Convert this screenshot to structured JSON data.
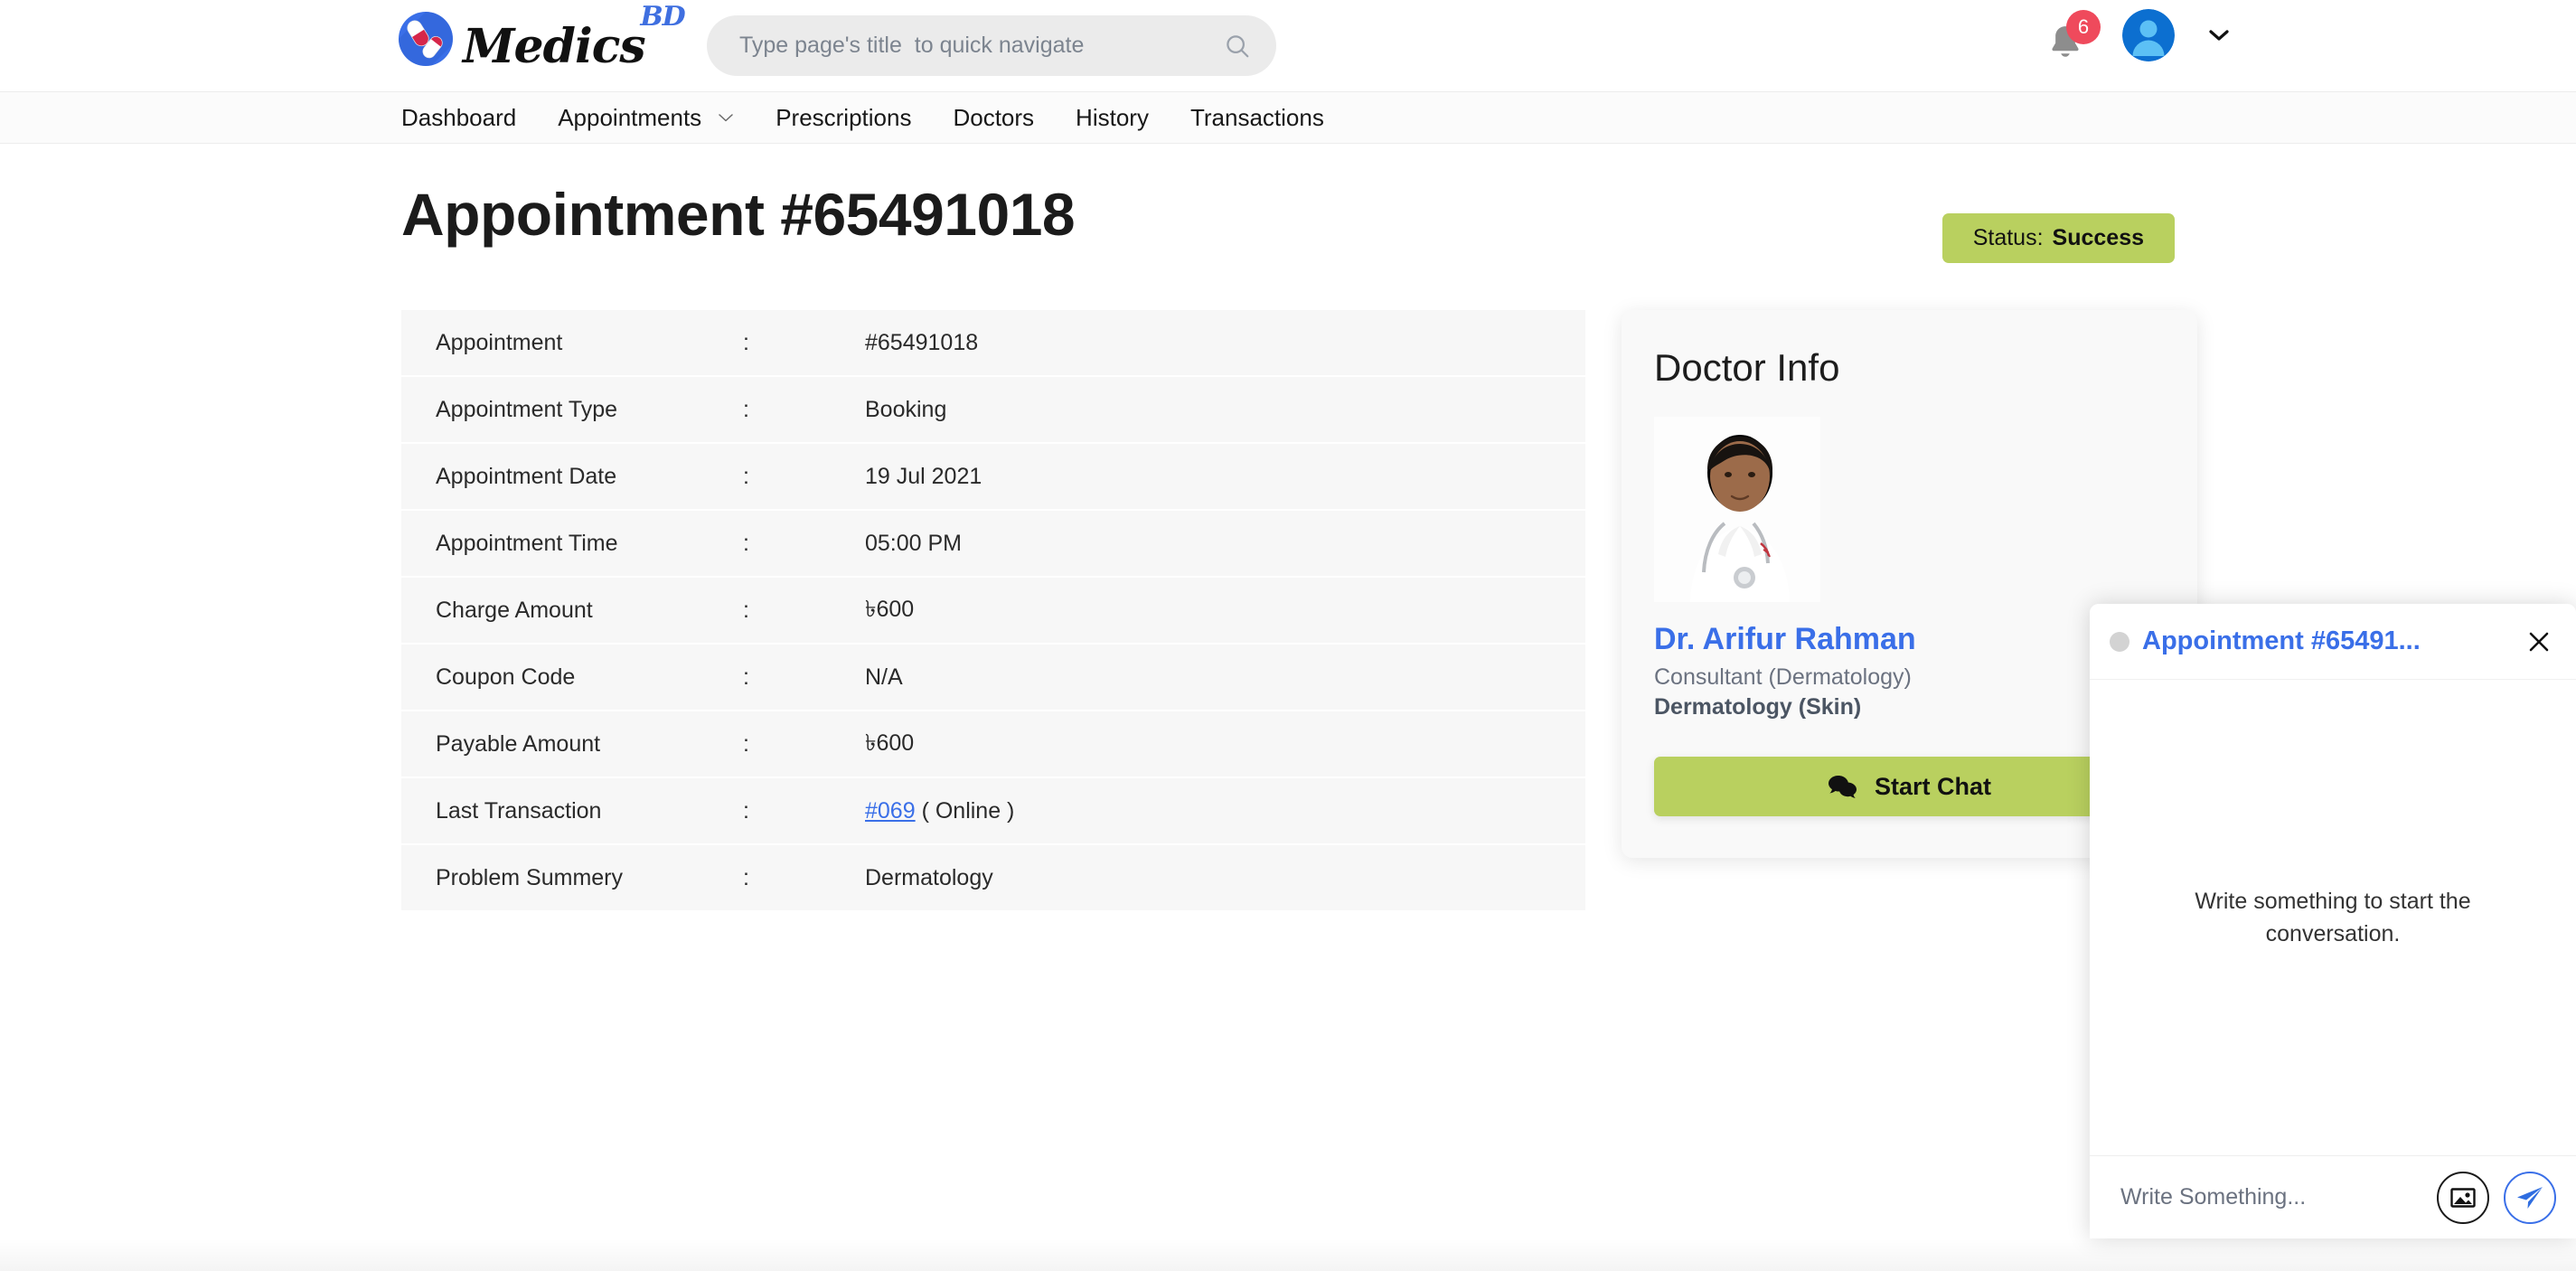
{
  "brand": {
    "name": "Medics",
    "superscript": "BD",
    "logo_icon": "pills-capsule-icon"
  },
  "search": {
    "placeholder": "Type page's title  to quick navigate",
    "value": "",
    "icon": "search-icon"
  },
  "topbar": {
    "notification_icon": "bell-icon",
    "notification_count": "6",
    "avatar_icon": "user-avatar-icon",
    "account_caret_icon": "chevron-down-icon"
  },
  "nav": {
    "items": [
      {
        "label": "Dashboard",
        "has_caret": false
      },
      {
        "label": "Appointments",
        "has_caret": true
      },
      {
        "label": "Prescriptions",
        "has_caret": false
      },
      {
        "label": "Doctors",
        "has_caret": false
      },
      {
        "label": "History",
        "has_caret": false
      },
      {
        "label": "Transactions",
        "has_caret": false
      }
    ]
  },
  "page": {
    "title": "Appointment #65491018",
    "status_label": "Status:",
    "status_value": "Success",
    "status_color": "#b9d05f"
  },
  "details": {
    "rows": [
      {
        "label": "Appointment",
        "sep": ":",
        "value": "#65491018"
      },
      {
        "label": "Appointment Type",
        "sep": ":",
        "value": "Booking"
      },
      {
        "label": "Appointment Date",
        "sep": ":",
        "value": "19 Jul 2021"
      },
      {
        "label": "Appointment Time",
        "sep": ":",
        "value": "05:00 PM"
      },
      {
        "label": "Charge Amount",
        "sep": ":",
        "value": "৳600"
      },
      {
        "label": "Coupon Code",
        "sep": ":",
        "value": "N/A"
      },
      {
        "label": "Payable Amount",
        "sep": ":",
        "value": "৳600"
      },
      {
        "label": "Last Transaction",
        "sep": ":",
        "value": "#069 ( Online )",
        "link_text": "#069",
        "suffix": " ( Online )"
      },
      {
        "label": "Problem Summery",
        "sep": ":",
        "value": "Dermatology"
      }
    ]
  },
  "doctor": {
    "card_title": "Doctor Info",
    "photo_alt": "doctor-portrait",
    "name": "Dr. Arifur Rahman",
    "role": "Consultant (Dermatology)",
    "specialty": "Dermatology (Skin)",
    "chat_button_label": "Start Chat",
    "chat_button_icon": "chat-bubbles-icon",
    "chat_button_color": "#b9d05f"
  },
  "chat": {
    "status_dot": "offline-status-dot",
    "title": "Appointment #65491...",
    "close_icon": "close-icon",
    "empty_message": "Write something to start the conversation.",
    "input_placeholder": "Write Something...",
    "input_value": "",
    "attach_icon": "image-attach-icon",
    "send_icon": "send-paper-plane-icon",
    "accent_color": "#3a6fe8"
  }
}
